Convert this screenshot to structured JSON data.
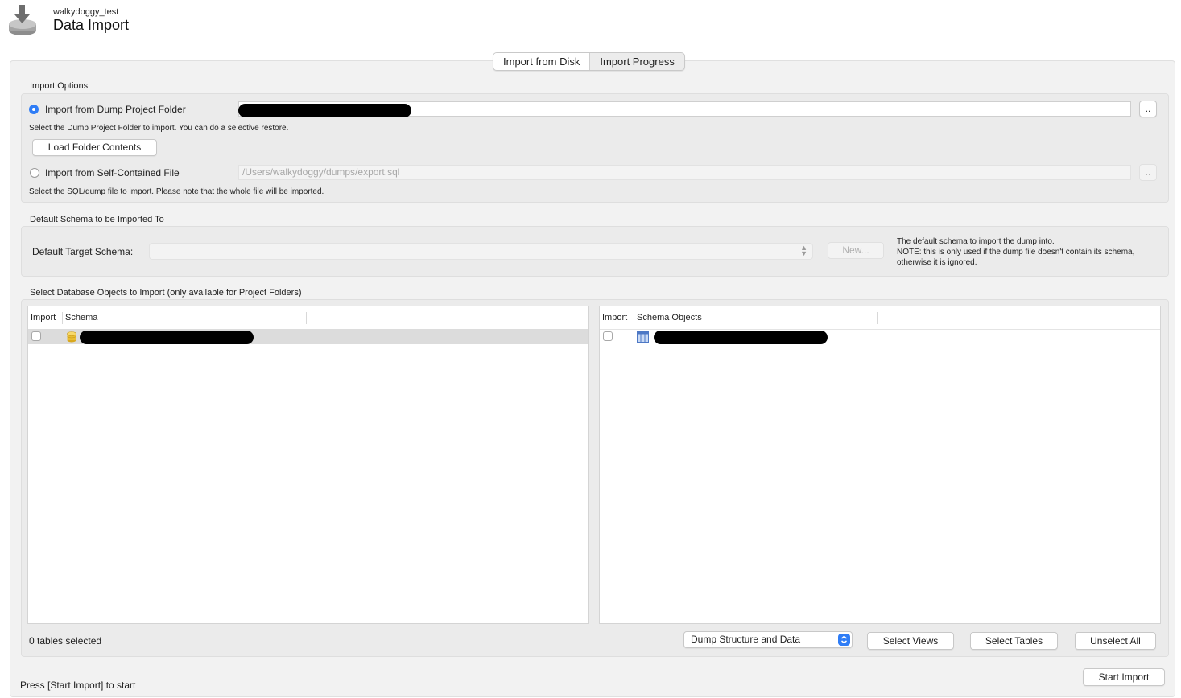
{
  "header": {
    "connection_name": "walkydoggy_test",
    "title": "Data Import"
  },
  "tabs": [
    {
      "label": "Import from Disk",
      "active": true
    },
    {
      "label": "Import Progress",
      "active": false
    }
  ],
  "import_options": {
    "section_label": "Import Options",
    "dump_folder": {
      "label": "Import from Dump Project Folder",
      "selected": true,
      "path_value": "",
      "browse_label": "..",
      "help": "Select the Dump Project Folder to import. You can do a selective restore.",
      "load_button": "Load Folder Contents"
    },
    "self_contained": {
      "label": "Import from Self-Contained File",
      "selected": false,
      "path_value": "/Users/walkydoggy/dumps/export.sql",
      "browse_label": "..",
      "help": "Select the SQL/dump file to import. Please note that the whole file will be imported."
    }
  },
  "default_schema": {
    "section_label": "Default Schema to be Imported To",
    "target_label": "Default Target Schema:",
    "selected_value": "",
    "new_button": "New...",
    "note_line1": "The default schema to import the dump into.",
    "note_line2": "NOTE: this is only used if the dump file doesn't contain its schema,",
    "note_line3": "otherwise it is ignored."
  },
  "objects": {
    "section_label": "Select Database Objects to Import (only available for Project Folders)",
    "schema_table": {
      "col_import": "Import",
      "col_schema": "Schema",
      "rows": [
        {
          "checked": false,
          "name": ""
        }
      ]
    },
    "objects_table": {
      "col_import": "Import",
      "col_objects": "Schema Objects",
      "rows": [
        {
          "checked": false,
          "name": ""
        }
      ]
    },
    "status": "0 tables selected",
    "dump_mode": "Dump Structure and Data",
    "select_views": "Select Views",
    "select_tables": "Select Tables",
    "unselect_all": "Unselect All"
  },
  "footer": {
    "status": "Press [Start Import] to start",
    "start_button": "Start Import"
  },
  "colors": {
    "accent": "#2f7df6",
    "panel_bg": "#f2f2f2"
  }
}
